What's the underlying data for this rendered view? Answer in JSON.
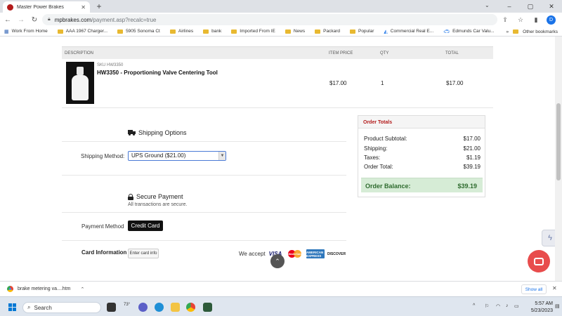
{
  "browser": {
    "tab_title": "Master Power Brakes",
    "url_domain": "mpbrakes.com",
    "url_path": "/payment.asp?recalc=true",
    "profile_initial": "D"
  },
  "bookmarks": [
    {
      "label": "Work From Home",
      "kind": "page"
    },
    {
      "label": "AAA 1967 Charger...",
      "kind": "folder"
    },
    {
      "label": "5905 Sonoma Ct",
      "kind": "folder"
    },
    {
      "label": "Airlines",
      "kind": "folder"
    },
    {
      "label": "bank",
      "kind": "folder"
    },
    {
      "label": "Imported From IE",
      "kind": "folder"
    },
    {
      "label": "News",
      "kind": "folder"
    },
    {
      "label": "Packard",
      "kind": "folder"
    },
    {
      "label": "Popular",
      "kind": "folder"
    },
    {
      "label": "Commercial Real E...",
      "kind": "page"
    },
    {
      "label": "Edmunds Car Valu...",
      "kind": "page"
    }
  ],
  "bookmarks_more": "»",
  "bookmarks_other": "Other bookmarks",
  "cart": {
    "headers": {
      "description": "DESCRIPTION",
      "price": "ITEM PRICE",
      "qty": "QTY",
      "total": "TOTAL"
    },
    "item": {
      "sku": "SKU HW3350",
      "name": "HW3350 - Proportioning Valve Centering Tool",
      "price": "$17.00",
      "qty": "1",
      "total": "$17.00"
    }
  },
  "shipping": {
    "title": "Shipping Options",
    "method_label": "Shipping Method:",
    "selected": "UPS Ground ($21.00)"
  },
  "payment": {
    "title": "Secure Payment",
    "subtitle": "All transactions are secure.",
    "method_label": "Payment Method",
    "method_button": "Credit Card",
    "card_info_label": "Card Information",
    "enter_card_button": "Enter card info",
    "we_accept": "We accept",
    "cards": [
      "VISA",
      "MasterCard",
      "AMERICAN EXPRESS",
      "DISCOVER"
    ]
  },
  "totals": {
    "title": "Order Totals",
    "lines": [
      {
        "label": "Product Subtotal:",
        "value": "$17.00"
      },
      {
        "label": "Shipping:",
        "value": "$21.00"
      },
      {
        "label": "Taxes:",
        "value": "$1.19"
      },
      {
        "label": "Order Total:",
        "value": "$39.19"
      }
    ],
    "balance_label": "Order Balance:",
    "balance_value": "$39.19"
  },
  "download": {
    "file": "brake metering va....htm",
    "show_all": "Show all"
  },
  "taskbar": {
    "search": "Search",
    "weather": "73°",
    "time": "5:57 AM",
    "date": "5/23/2023"
  },
  "colors": {
    "accent_red": "#b31b1b",
    "balance_green": "#d6ecd6",
    "chat_red": "#e84c4c"
  }
}
